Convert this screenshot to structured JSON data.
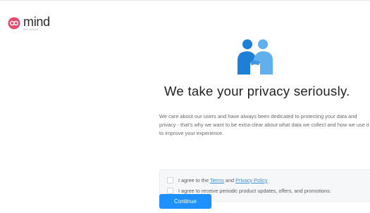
{
  "brand": {
    "name": "mind",
    "sub": "PRO BRAND",
    "logo_icon": "mind-logo-icon",
    "accent_color": "#e84a6f"
  },
  "hero": {
    "icon": "handshake-people-icon",
    "colors": [
      "#1e7fd6",
      "#5fb0ec"
    ]
  },
  "headline": "We take your privacy seriously.",
  "body": "We care about our users and have always been dedicated to protecting your data and privacy - that's why we want to be extra-clear about what data we collect and how we use it to improve your experience.",
  "consent": {
    "terms": {
      "prefix": "I agree to the ",
      "terms_link": "Terms",
      "and": " and ",
      "privacy_link": "Privacy Policy"
    },
    "updates_label": "I agree to receive periodic product updates, offers, and promotions."
  },
  "continue_label": "Continue",
  "primary_color": "#1e90ff"
}
